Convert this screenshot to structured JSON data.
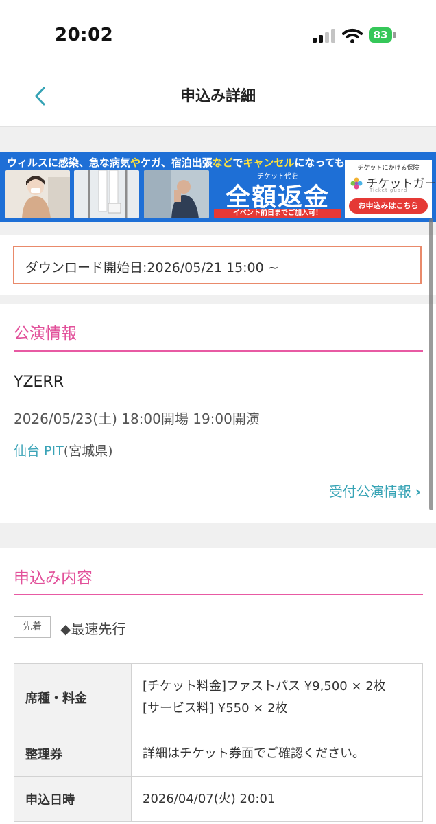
{
  "status_bar": {
    "time": "20:02",
    "battery": "83"
  },
  "header": {
    "title": "申込み詳細",
    "back_icon": "chevron-left-icon"
  },
  "banner": {
    "headline_parts": [
      "ウィルスに感染、急な病気",
      "や",
      "ケガ、宿泊出張",
      "など",
      "で",
      "キャンセル",
      "に",
      "なっても…"
    ],
    "refund_small": "チケット代を",
    "refund_big": "全額返金",
    "refund_note": "イベント前日までご加入可！",
    "guard_small": "チケットにかける保険",
    "guard_logo": "チケットガード",
    "guard_sub": "Ticket guard",
    "guard_button": "お申込みはこちら"
  },
  "download": {
    "text": "ダウンロード開始日:2026/05/21 15:00 ~"
  },
  "performance": {
    "section_title": "公演情報",
    "artist": "YZERR",
    "datetime": "2026/05/23(土) 18:00開場 19:00開演",
    "venue": "仙台 PIT",
    "prefecture": "(宮城県)",
    "link_label": "受付公演情報"
  },
  "application": {
    "section_title": "申込み内容",
    "badge": "先着",
    "priority": "◆最速先行",
    "rows": [
      {
        "label": "席種・料金",
        "lines": [
          "[チケット料金]ファストパス ¥9,500 × 2枚",
          "[サービス料] ¥550 × 2枚"
        ]
      },
      {
        "label": "整理券",
        "lines": [
          "詳細はチケット券面でご確認ください。"
        ]
      },
      {
        "label": "申込日時",
        "lines": [
          "2026/04/07(火) 20:01"
        ]
      }
    ]
  },
  "colors": {
    "accent_pink": "#e2509a",
    "accent_teal": "#36a3b5",
    "download_border": "#e98a6b",
    "banner_blue": "#1e6fd6"
  }
}
